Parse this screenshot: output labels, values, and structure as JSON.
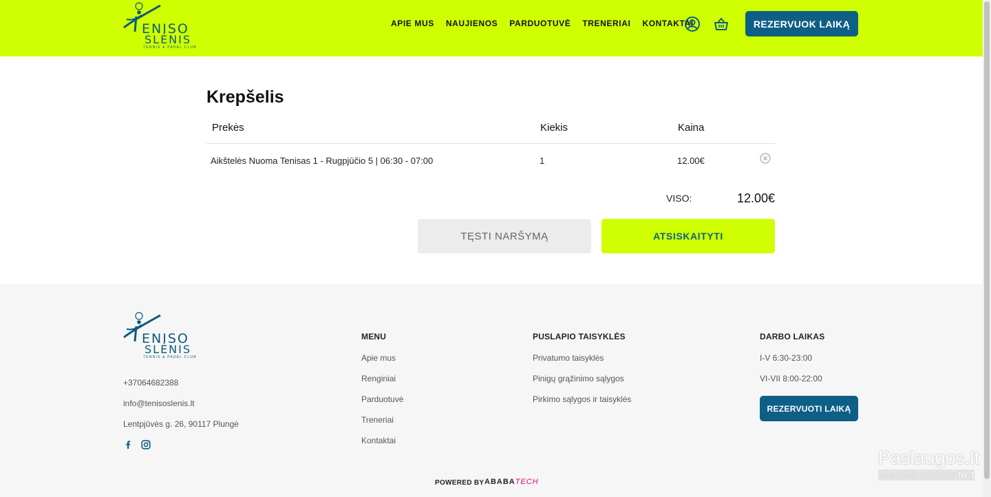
{
  "brand": {
    "logo_line1": "ENISO",
    "logo_line2": "SLĖNIS",
    "logo_tagline": "TENNIS & PADEL CLUB",
    "accent_color": "#cfff00",
    "primary_color": "#0e5f86"
  },
  "header": {
    "nav": [
      {
        "label": "APIE MUS"
      },
      {
        "label": "NAUJIENOS"
      },
      {
        "label": "PARDUOTUVĖ"
      },
      {
        "label": "TRENERIAI"
      },
      {
        "label": "KONTAKTAI"
      }
    ],
    "account_icon": "user-circle-icon",
    "cart_icon": "basket-icon",
    "reserve_button": "REZERVUOK LAIKĄ"
  },
  "cart": {
    "title": "Krepšelis",
    "columns": {
      "item": "Prekės",
      "qty": "Kiekis",
      "price": "Kaina"
    },
    "rows": [
      {
        "item": "Aikštelės Nuoma Tenisas 1 - Rugpjūčio 5 | 06:30 - 07:00",
        "qty": "1",
        "price": "12.00€"
      }
    ],
    "remove_icon": "close-circle-icon",
    "total_label": "VISO:",
    "total_value": "12.00€",
    "continue_button": "TĘSTI NARŠYMĄ",
    "checkout_button": "ATSISKAITYTI"
  },
  "footer": {
    "phone": "+37064682388",
    "email": "info@tenisoslenis.lt",
    "address": "Lentpjūvės g. 26, 90117 Plungė",
    "social": [
      "facebook-icon",
      "instagram-icon"
    ],
    "menu": {
      "heading": "MENU",
      "links": [
        "Apie mus",
        "Renginiai",
        "Parduotuvė",
        "Treneriai",
        "Kontaktai"
      ]
    },
    "rules": {
      "heading": "PUSLAPIO TAISYKLĖS",
      "links": [
        "Privatumo taisyklės",
        "Pinigų grąžinimo sąlygos",
        "Pirkimo sąlygos ir taisyklės"
      ]
    },
    "hours": {
      "heading": "DARBO LAIKAS",
      "lines": [
        "I-V 6:30-23:00",
        "VI-VII 8:00-22:00"
      ],
      "button": "REZERVUOTI LAIKĄ"
    },
    "powered_by": "POWERED BY",
    "powered_brand_a": "ABABA",
    "powered_brand_b": "TECH"
  },
  "watermark": {
    "title": "Paslaugos.lt",
    "subtitle": "PASLAUGŲ PORTALAS",
    "rank": "Nr.1"
  }
}
